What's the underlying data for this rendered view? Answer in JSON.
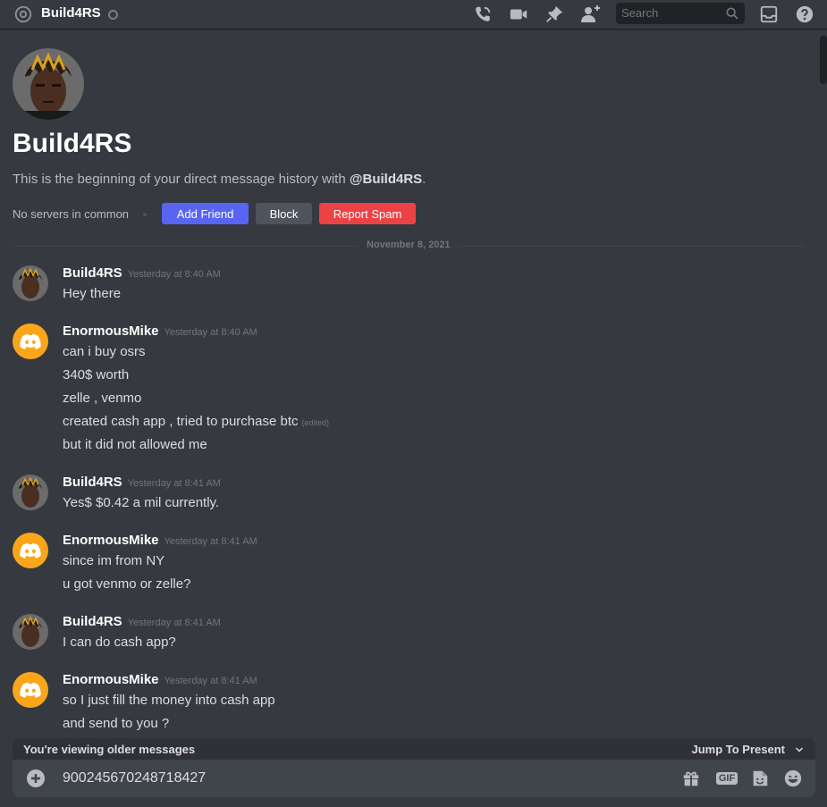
{
  "topbar": {
    "title": "Build4RS",
    "search_placeholder": "Search",
    "icons": [
      "at-icon",
      "call-icon",
      "video-icon",
      "pin-icon",
      "add-friend-icon",
      "search-icon",
      "inbox-icon",
      "help-icon"
    ]
  },
  "profile": {
    "name": "Build4RS",
    "intro_prefix": "This is the beginning of your direct message history with ",
    "intro_handle": "@Build4RS",
    "intro_suffix": ".",
    "no_servers": "No servers in common",
    "add_friend": "Add Friend",
    "block": "Block",
    "report_spam": "Report Spam"
  },
  "divider_date": "November 8, 2021",
  "messages": [
    {
      "author": "Build4RS",
      "time": "Yesterday at 8:40 AM",
      "avatar": "photo",
      "lines": [
        "Hey there"
      ]
    },
    {
      "author": "EnormousMike",
      "time": "Yesterday at 8:40 AM",
      "avatar": "discord",
      "lines": [
        "can i buy osrs",
        "340$ worth",
        "zelle , venmo",
        "created cash app , tried to purchase btc",
        "but it did not allowed me"
      ],
      "edited_label": "(edited)"
    },
    {
      "author": "Build4RS",
      "time": "Yesterday at 8:41 AM",
      "avatar": "photo",
      "lines": [
        "Yes$ $0.42 a mil currently."
      ]
    },
    {
      "author": "EnormousMike",
      "time": "Yesterday at 8:41 AM",
      "avatar": "discord",
      "lines": [
        "since im from NY",
        "u got venmo or zelle?"
      ]
    },
    {
      "author": "Build4RS",
      "time": "Yesterday at 8:41 AM",
      "avatar": "photo",
      "lines": [
        "I can do cash app?"
      ]
    },
    {
      "author": "EnormousMike",
      "time": "Yesterday at 8:41 AM",
      "avatar": "discord",
      "lines": [
        "so I just fill the money into cash app",
        "and send to you ?"
      ]
    }
  ],
  "older_bar": {
    "label": "You're viewing older messages",
    "jump": "Jump To Present"
  },
  "composer": {
    "value": "900245670248718427",
    "gif_label": "GIF"
  },
  "colors": {
    "background": "#36393f",
    "blurple": "#5865f2",
    "red": "#ed4245",
    "discord_avatar": "#faa61a"
  }
}
